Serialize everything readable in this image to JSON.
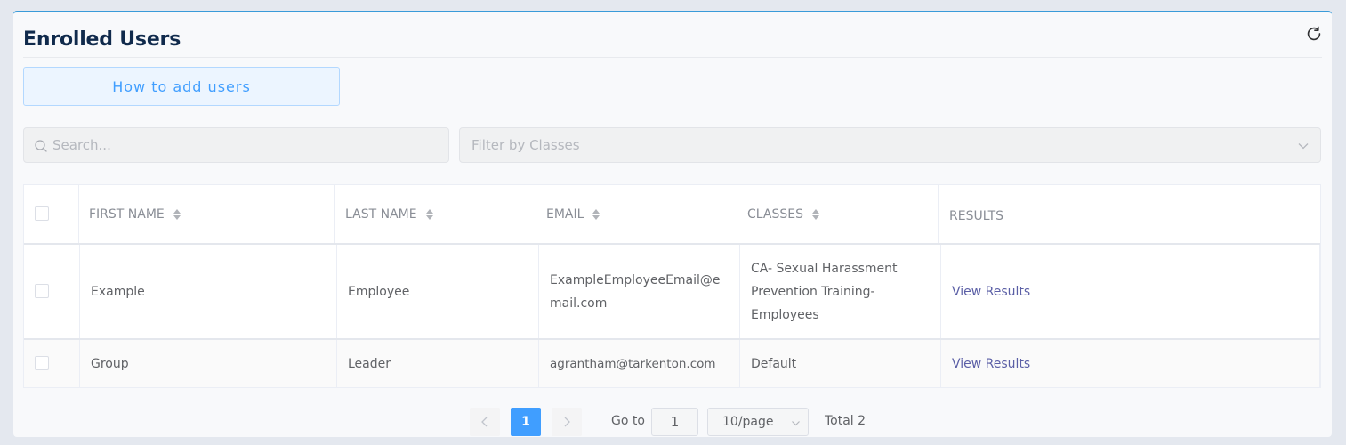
{
  "header": {
    "title": "Enrolled Users",
    "refresh_icon": "refresh-icon"
  },
  "howto_button": {
    "label": "How to add users"
  },
  "search": {
    "placeholder": "Search...",
    "icon": "search-icon"
  },
  "filter": {
    "placeholder": "Filter by Classes",
    "icon": "chevron-down-icon"
  },
  "table": {
    "columns": [
      {
        "label": "FIRST NAME",
        "sortable": true
      },
      {
        "label": "LAST NAME",
        "sortable": true
      },
      {
        "label": "EMAIL",
        "sortable": true
      },
      {
        "label": "CLASSES",
        "sortable": true
      },
      {
        "label": "RESULTS",
        "sortable": false
      }
    ],
    "rows": [
      {
        "first_name": "Example",
        "last_name": "Employee",
        "email": "ExampleEmployeeEmail@email.com",
        "classes": "CA- Sexual Harassment Prevention Training- Employees",
        "results": "View Results"
      },
      {
        "first_name": "Group",
        "last_name": "Leader",
        "email": "agrantham@tarkenton.com",
        "classes": "Default",
        "results": "View Results"
      }
    ]
  },
  "pagination": {
    "current_page": "1",
    "goto_label": "Go to",
    "goto_value": "1",
    "page_size": "10/page",
    "total": "Total 2"
  },
  "colors": {
    "accent": "#409eff",
    "card_border": "#3a9bd9",
    "title": "#102a4c",
    "link": "#5b5fa6"
  }
}
